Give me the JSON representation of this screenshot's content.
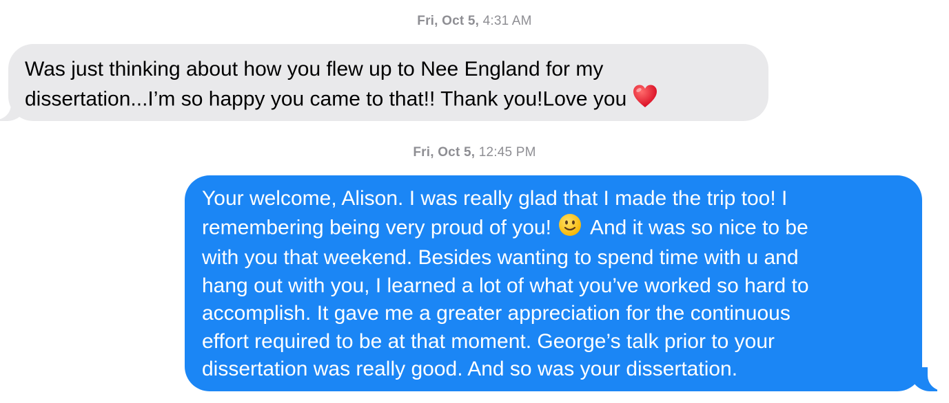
{
  "conversation": {
    "timestamps": [
      {
        "day": "Fri, Oct 5,",
        "time": "4:31 AM"
      },
      {
        "day": "Fri, Oct 5,",
        "time": "12:45 PM"
      }
    ],
    "received_message": {
      "lines": [
        "Was just thinking about how you flew up to Nee England for my",
        "dissertation...I’m so happy you came to that!! Thank you!Love you"
      ],
      "emoji": "red-heart"
    },
    "sent_message": {
      "lines": [
        "Your welcome, Alison. I was really glad that I made the trip too! I",
        "remembering being very proud of you!",
        "And it was so nice to be",
        "with you that weekend. Besides wanting to spend time with u and",
        "hang out with you, I learned a lot of what you’ve worked so hard to",
        "accomplish. It gave me a greater appreciation for the continuous",
        "effort required to be at that moment. George’s talk prior to your",
        "dissertation was really good. And so was your dissertation."
      ],
      "emoji": "slightly-smiling-face"
    },
    "colors": {
      "sent_bubble": "#1b86f5",
      "received_bubble": "#e9e9eb",
      "timestamp_text": "#8e8e93"
    }
  }
}
